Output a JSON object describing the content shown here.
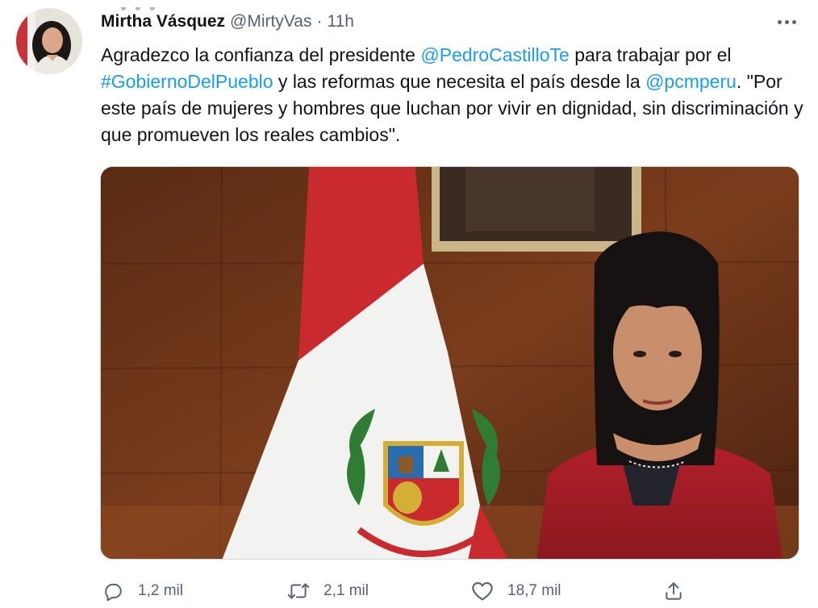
{
  "tweet": {
    "author_name": "Mirtha Vásquez",
    "handle": "@MirtyVas",
    "separator": "·",
    "time": "11h",
    "text": {
      "p1": "Agradezco la confianza del presidente ",
      "mention1": "@PedroCastilloTe",
      "p2": " para trabajar por el ",
      "hashtag1": "#GobiernoDelPueblo",
      "p3": " y las reformas que necesita el país desde la ",
      "mention2": "@pcmperu",
      "p4": ". \"Por este país de mujeres y hombres que luchan por vivir en dignidad, sin discriminación y que promueven los reales cambios\"."
    }
  },
  "actions": {
    "reply": {
      "icon": "reply-icon",
      "count": "1,2 mil"
    },
    "retweet": {
      "icon": "retweet-icon",
      "count": "2,1 mil"
    },
    "like": {
      "icon": "heart-icon",
      "count": "18,7 mil"
    },
    "share": {
      "icon": "share-icon"
    }
  },
  "colors": {
    "link": "#1d9bf0",
    "text": "#0f1419",
    "secondary": "#536471",
    "border": "#cfd9de"
  }
}
